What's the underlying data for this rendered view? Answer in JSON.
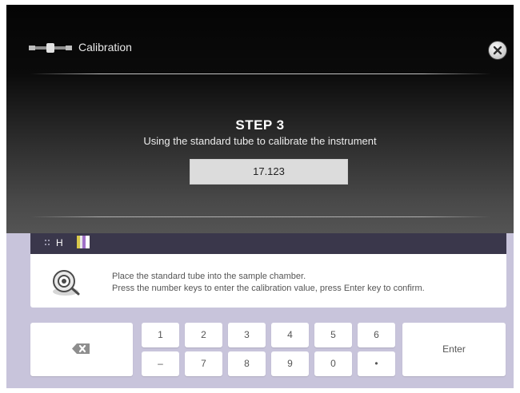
{
  "header": {
    "title": "Calibration"
  },
  "step": {
    "title": "STEP 3",
    "subtitle": "Using the standard tube to calibrate the instrument",
    "value": "17.123"
  },
  "help": {
    "label": "H",
    "line1": "Place the standard tube into the sample chamber.",
    "line2": "Press the number keys to enter the calibration value, press Enter key to confirm."
  },
  "keypad": {
    "row1": [
      "1",
      "2",
      "3",
      "4",
      "5",
      "6"
    ],
    "row2": [
      "–",
      "7",
      "8",
      "9",
      "0",
      "•"
    ],
    "enter": "Enter"
  }
}
